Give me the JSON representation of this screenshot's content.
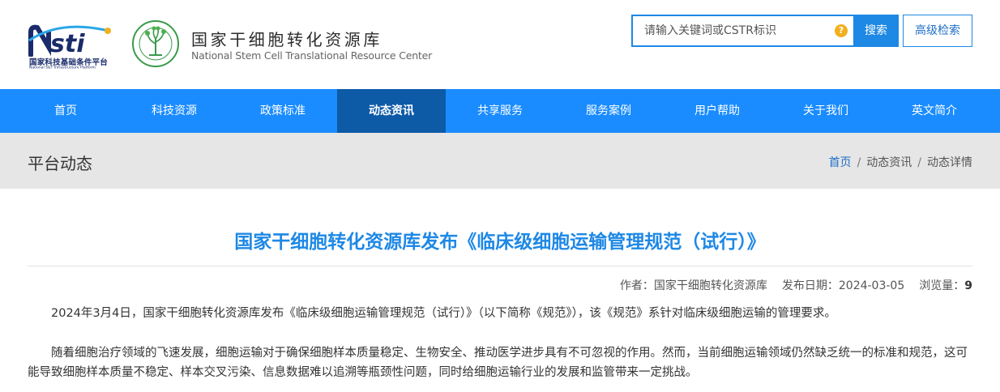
{
  "header": {
    "nsti_cn": "国家科技基础条件平台",
    "nsti_en": "National S&T Infrastructure Platform",
    "site_name_cn": "国家干细胞转化资源库",
    "site_name_en": "National Stem Cell Translational Resource Center"
  },
  "search": {
    "placeholder": "请输入关键词或CSTR标识",
    "button_label": "搜索",
    "advanced_label": "高级检索"
  },
  "nav": {
    "items": [
      "首页",
      "科技资源",
      "政策标准",
      "动态资讯",
      "共享服务",
      "服务案例",
      "用户帮助",
      "关于我们",
      "英文简介"
    ],
    "active_index": 3
  },
  "titlebar": {
    "section_title": "平台动态",
    "breadcrumb": [
      "首页",
      "动态资讯",
      "动态详情"
    ]
  },
  "article": {
    "title": "国家干细胞转化资源库发布《临床级细胞运输管理规范（试行）》",
    "author_label": "作者：",
    "author": "国家干细胞转化资源库",
    "date_label": "发布日期：",
    "date": "2024-03-05",
    "views_label": "浏览量：",
    "views": "9",
    "paragraphs": [
      "2024年3月4日，国家干细胞转化资源库发布《临床级细胞运输管理规范（试行）》（以下简称《规范》），该《规范》系针对临床级细胞运输的管理要求。",
      "随着细胞治疗领域的飞速发展，细胞运输对于确保细胞样本质量稳定、生物安全、推动医学进步具有不可忽视的作用。然而，当前细胞运输领域仍然缺乏统一的标准和规范，这可能导致细胞样本质量不稳定、样本交叉污染、信息数据难以追溯等瓶颈性问题，同时给细胞运输行业的发展和监管带来一定挑战。"
    ]
  },
  "colors": {
    "primary": "#1e88e5",
    "nav_bg": "#1a8cff",
    "nav_active": "#0d5aa7",
    "titlebar_bg": "#e6e6e6"
  }
}
